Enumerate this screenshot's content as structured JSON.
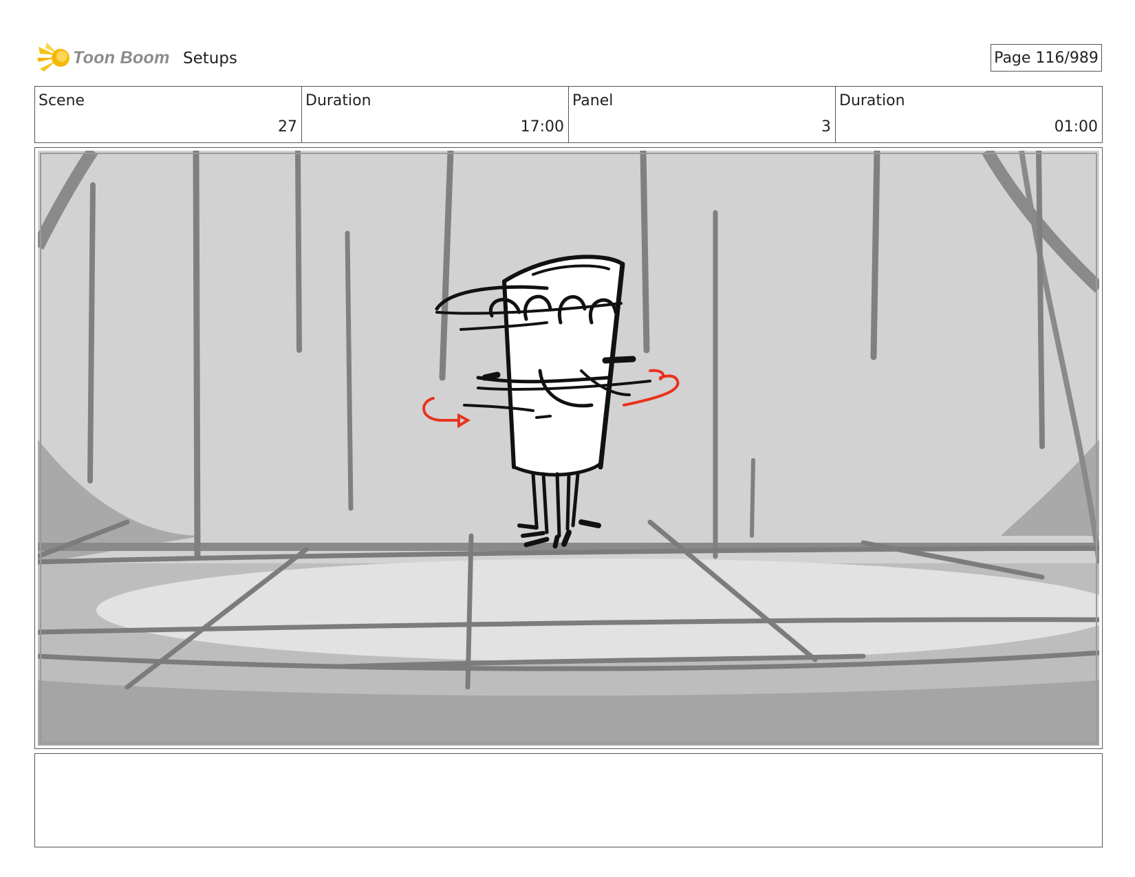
{
  "header": {
    "logo_text": "Toon Boom",
    "title": "Setups",
    "page_indicator": "Page 116/989"
  },
  "info": {
    "scene_label": "Scene",
    "scene_value": "27",
    "scene_duration_label": "Duration",
    "scene_duration_value": "17:00",
    "panel_label": "Panel",
    "panel_value": "3",
    "panel_duration_label": "Duration",
    "panel_duration_value": "01:00"
  },
  "notes": {
    "text": ""
  },
  "colors": {
    "sketch_background": "#d2d2d2",
    "stroke_grey": "#808080",
    "annotation_red": "#e8321e",
    "logo_yellow": "#f7c21b"
  }
}
